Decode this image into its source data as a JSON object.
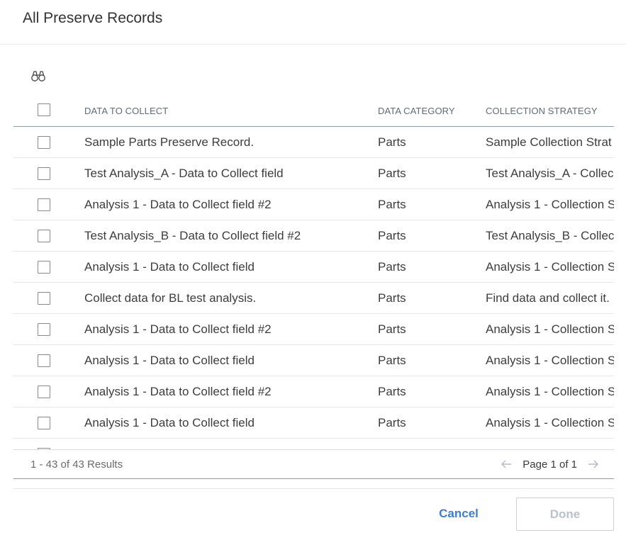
{
  "dialog": {
    "title": "All Preserve Records"
  },
  "toolbar": {
    "search_icon": "binoculars-icon"
  },
  "table": {
    "columns": [
      "DATA TO COLLECT",
      "DATA CATEGORY",
      "COLLECTION STRATEGY"
    ],
    "rows": [
      {
        "data": "Sample Parts Preserve Record.",
        "category": "Parts",
        "strategy": "Sample Collection Strat"
      },
      {
        "data": "Test Analysis_A - Data to Collect field",
        "category": "Parts",
        "strategy": "Test Analysis_A - Collec"
      },
      {
        "data": "Analysis 1 - Data to Collect field #2",
        "category": "Parts",
        "strategy": "Analysis 1 - Collection S"
      },
      {
        "data": "Test Analysis_B - Data to Collect field #2",
        "category": "Parts",
        "strategy": "Test Analysis_B - Collec"
      },
      {
        "data": "Analysis 1 - Data to Collect field",
        "category": "Parts",
        "strategy": "Analysis 1 - Collection S"
      },
      {
        "data": "Collect data for BL test analysis.",
        "category": "Parts",
        "strategy": "Find data and collect it."
      },
      {
        "data": "Analysis 1 - Data to Collect field #2",
        "category": "Parts",
        "strategy": "Analysis 1 - Collection S"
      },
      {
        "data": "Analysis 1 - Data to Collect field",
        "category": "Parts",
        "strategy": "Analysis 1 - Collection S"
      },
      {
        "data": "Analysis 1 - Data to Collect field #2",
        "category": "Parts",
        "strategy": "Analysis 1 - Collection S"
      },
      {
        "data": "Analysis 1 - Data to Collect field",
        "category": "Parts",
        "strategy": "Analysis 1 - Collection S"
      }
    ]
  },
  "footer": {
    "results": "1 - 43 of 43 Results",
    "page": "Page 1 of 1"
  },
  "actions": {
    "cancel": "Cancel",
    "done": "Done"
  },
  "colors": {
    "accent": "#3a7fd4",
    "disabled": "#b9c2cc",
    "border": "#8e99a4"
  }
}
